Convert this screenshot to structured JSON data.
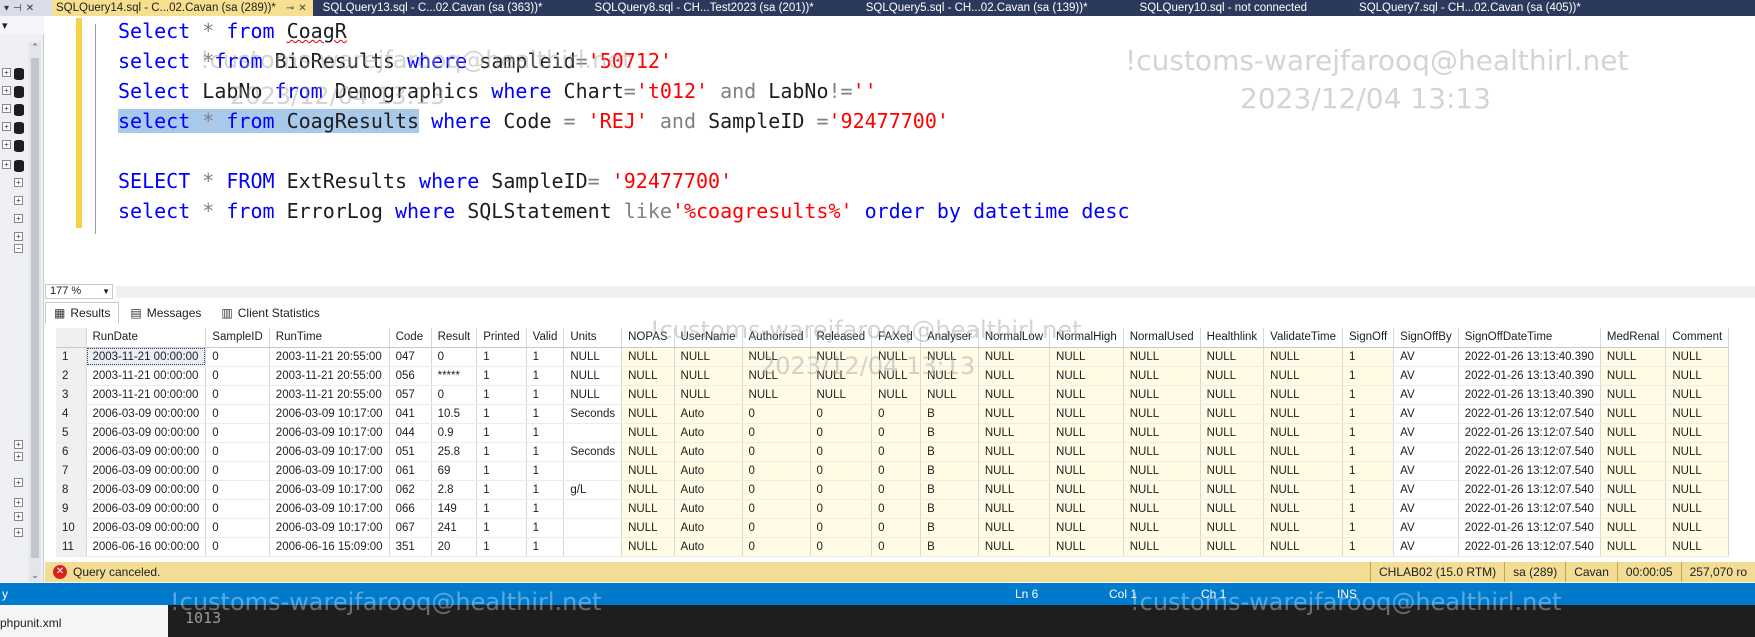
{
  "tabs": [
    {
      "label": "SQLQuery14.sql - C...02.Cavan (sa (289))*",
      "active": true
    },
    {
      "label": "SQLQuery13.sql - C...02.Cavan (sa (363))*"
    },
    {
      "label": "SQLQuery8.sql - CH...Test2023 (sa (201))*"
    },
    {
      "label": "SQLQuery5.sql - CH...02.Cavan (sa (139))*"
    },
    {
      "label": "SQLQuery10.sql - not connected"
    },
    {
      "label": "SQLQuery7.sql - CH...02.Cavan (sa (405))*"
    }
  ],
  "editor": {
    "zoom": "177 %",
    "lines": [
      [
        {
          "t": "Select",
          "c": "kw"
        },
        {
          "t": " * ",
          "c": "op"
        },
        {
          "t": "from",
          "c": "kw"
        },
        {
          "t": " ",
          "c": "id"
        },
        {
          "t": "CoagR",
          "c": "squig"
        }
      ],
      [
        {
          "t": "select",
          "c": "kw"
        },
        {
          "t": " *",
          "c": "op"
        },
        {
          "t": "from",
          "c": "kw"
        },
        {
          "t": " BioResults ",
          "c": "id"
        },
        {
          "t": "where",
          "c": "kw"
        },
        {
          "t": " sampleid",
          "c": "id"
        },
        {
          "t": "=",
          "c": "op"
        },
        {
          "t": "'50712'",
          "c": "str"
        }
      ],
      [
        {
          "t": "Select",
          "c": "kw"
        },
        {
          "t": " LabNo ",
          "c": "id"
        },
        {
          "t": "from",
          "c": "kw"
        },
        {
          "t": " Demographics ",
          "c": "id"
        },
        {
          "t": "where",
          "c": "kw"
        },
        {
          "t": " Chart",
          "c": "id"
        },
        {
          "t": "=",
          "c": "op"
        },
        {
          "t": "'t012'",
          "c": "str"
        },
        {
          "t": " and ",
          "c": "op"
        },
        {
          "t": "LabNo",
          "c": "id"
        },
        {
          "t": "!=",
          "c": "op"
        },
        {
          "t": "''",
          "c": "str"
        }
      ],
      [
        {
          "t": "select",
          "c": "kw sel"
        },
        {
          "t": " * ",
          "c": "op sel"
        },
        {
          "t": "from",
          "c": "kw sel"
        },
        {
          "t": " CoagResults",
          "c": "id sel"
        },
        {
          "t": " where",
          "c": "kw"
        },
        {
          "t": " Code ",
          "c": "id"
        },
        {
          "t": "=",
          "c": "op"
        },
        {
          "t": " 'REJ'",
          "c": "str"
        },
        {
          "t": " and ",
          "c": "op"
        },
        {
          "t": "SampleID ",
          "c": "id"
        },
        {
          "t": "=",
          "c": "op"
        },
        {
          "t": "'92477700'",
          "c": "str"
        }
      ],
      [],
      [
        {
          "t": "SELECT",
          "c": "kw"
        },
        {
          "t": " * ",
          "c": "op"
        },
        {
          "t": "FROM",
          "c": "kw"
        },
        {
          "t": " ExtResults ",
          "c": "id"
        },
        {
          "t": "where",
          "c": "kw"
        },
        {
          "t": " SampleID",
          "c": "id"
        },
        {
          "t": "=",
          "c": "op"
        },
        {
          "t": " '92477700'",
          "c": "str"
        }
      ],
      [
        {
          "t": "select",
          "c": "kw"
        },
        {
          "t": " * ",
          "c": "op"
        },
        {
          "t": "from",
          "c": "kw"
        },
        {
          "t": " ErrorLog ",
          "c": "id"
        },
        {
          "t": "where",
          "c": "kw"
        },
        {
          "t": " SQLStatement ",
          "c": "id"
        },
        {
          "t": "like",
          "c": "op"
        },
        {
          "t": "'%coagresults%'",
          "c": "str"
        },
        {
          "t": " order by ",
          "c": "kw"
        },
        {
          "t": "datetime",
          "c": "kw"
        },
        {
          "t": " desc",
          "c": "kw"
        }
      ]
    ]
  },
  "results_tabs": {
    "results": "Results",
    "messages": "Messages",
    "client_statistics": "Client Statistics"
  },
  "grid": {
    "columns": [
      "RunDate",
      "SampleID",
      "RunTime",
      "Code",
      "Result",
      "Printed",
      "Valid",
      "Units",
      "NOPAS",
      "UserName",
      "Authorised",
      "Released",
      "FAXed",
      "Analyser",
      "NormalLow",
      "NormalHigh",
      "NormalUsed",
      "Healthlink",
      "ValidateTime",
      "SignOff",
      "SignOffBy",
      "SignOffDateTime",
      "MedRenal",
      "Comment"
    ],
    "rows": [
      [
        "1",
        "2003-11-21 00:00:00",
        "0",
        "2003-11-21 20:55:00",
        "047",
        "0",
        "1",
        "1",
        "NULL",
        "NULL",
        "NULL",
        "NULL",
        "NULL",
        "NULL",
        "NULL",
        "NULL",
        "NULL",
        "NULL",
        "NULL",
        "NULL",
        "1",
        "AV",
        "2022-01-26 13:13:40.390",
        "NULL",
        "NULL"
      ],
      [
        "2",
        "2003-11-21 00:00:00",
        "0",
        "2003-11-21 20:55:00",
        "056",
        "*****",
        "1",
        "1",
        "NULL",
        "NULL",
        "NULL",
        "NULL",
        "NULL",
        "NULL",
        "NULL",
        "NULL",
        "NULL",
        "NULL",
        "NULL",
        "NULL",
        "1",
        "AV",
        "2022-01-26 13:13:40.390",
        "NULL",
        "NULL"
      ],
      [
        "3",
        "2003-11-21 00:00:00",
        "0",
        "2003-11-21 20:55:00",
        "057",
        "0",
        "1",
        "1",
        "NULL",
        "NULL",
        "NULL",
        "NULL",
        "NULL",
        "NULL",
        "NULL",
        "NULL",
        "NULL",
        "NULL",
        "NULL",
        "NULL",
        "1",
        "AV",
        "2022-01-26 13:13:40.390",
        "NULL",
        "NULL"
      ],
      [
        "4",
        "2006-03-09 00:00:00",
        "0",
        "2006-03-09 10:17:00",
        "041",
        "10.5",
        "1",
        "1",
        "Seconds",
        "NULL",
        "Auto",
        "0",
        "0",
        "0",
        "B",
        "NULL",
        "NULL",
        "NULL",
        "NULL",
        "NULL",
        "1",
        "AV",
        "2022-01-26 13:12:07.540",
        "NULL",
        "NULL"
      ],
      [
        "5",
        "2006-03-09 00:00:00",
        "0",
        "2006-03-09 10:17:00",
        "044",
        "0.9",
        "1",
        "1",
        "",
        "NULL",
        "Auto",
        "0",
        "0",
        "0",
        "B",
        "NULL",
        "NULL",
        "NULL",
        "NULL",
        "NULL",
        "1",
        "AV",
        "2022-01-26 13:12:07.540",
        "NULL",
        "NULL"
      ],
      [
        "6",
        "2006-03-09 00:00:00",
        "0",
        "2006-03-09 10:17:00",
        "051",
        "25.8",
        "1",
        "1",
        "Seconds",
        "NULL",
        "Auto",
        "0",
        "0",
        "0",
        "B",
        "NULL",
        "NULL",
        "NULL",
        "NULL",
        "NULL",
        "1",
        "AV",
        "2022-01-26 13:12:07.540",
        "NULL",
        "NULL"
      ],
      [
        "7",
        "2006-03-09 00:00:00",
        "0",
        "2006-03-09 10:17:00",
        "061",
        "69",
        "1",
        "1",
        "",
        "NULL",
        "Auto",
        "0",
        "0",
        "0",
        "B",
        "NULL",
        "NULL",
        "NULL",
        "NULL",
        "NULL",
        "1",
        "AV",
        "2022-01-26 13:12:07.540",
        "NULL",
        "NULL"
      ],
      [
        "8",
        "2006-03-09 00:00:00",
        "0",
        "2006-03-09 10:17:00",
        "062",
        "2.8",
        "1",
        "1",
        "g/L",
        "NULL",
        "Auto",
        "0",
        "0",
        "0",
        "B",
        "NULL",
        "NULL",
        "NULL",
        "NULL",
        "NULL",
        "1",
        "AV",
        "2022-01-26 13:12:07.540",
        "NULL",
        "NULL"
      ],
      [
        "9",
        "2006-03-09 00:00:00",
        "0",
        "2006-03-09 10:17:00",
        "066",
        "149",
        "1",
        "1",
        "",
        "NULL",
        "Auto",
        "0",
        "0",
        "0",
        "B",
        "NULL",
        "NULL",
        "NULL",
        "NULL",
        "NULL",
        "1",
        "AV",
        "2022-01-26 13:12:07.540",
        "NULL",
        "NULL"
      ],
      [
        "10",
        "2006-03-09 00:00:00",
        "0",
        "2006-03-09 10:17:00",
        "067",
        "241",
        "1",
        "1",
        "",
        "NULL",
        "Auto",
        "0",
        "0",
        "0",
        "B",
        "NULL",
        "NULL",
        "NULL",
        "NULL",
        "NULL",
        "1",
        "AV",
        "2022-01-26 13:12:07.540",
        "NULL",
        "NULL"
      ],
      [
        "11",
        "2006-06-16 00:00:00",
        "0",
        "2006-06-16 15:09:00",
        "351",
        "20",
        "1",
        "1",
        "",
        "NULL",
        "Auto",
        "0",
        "0",
        "0",
        "B",
        "NULL",
        "NULL",
        "NULL",
        "NULL",
        "NULL",
        "1",
        "AV",
        "2022-01-26 13:12:07.540",
        "NULL",
        "NULL"
      ]
    ]
  },
  "query_status": {
    "message": "Query canceled.",
    "server": "CHLAB02 (15.0 RTM)",
    "user": "sa (289)",
    "database": "Cavan",
    "elapsed": "00:00:05",
    "rows": "257,070 ro"
  },
  "app_status": {
    "left": "y",
    "ln": "Ln 6",
    "col": "Col 1",
    "ch": "Ch 1",
    "mode": "INS"
  },
  "bottom": {
    "file": "phpunit.xml",
    "line_number": "1013"
  },
  "watermarks": {
    "text": "!customs-warejfarooq@healthirl.net",
    "date": "2023/12/04 13:13"
  }
}
